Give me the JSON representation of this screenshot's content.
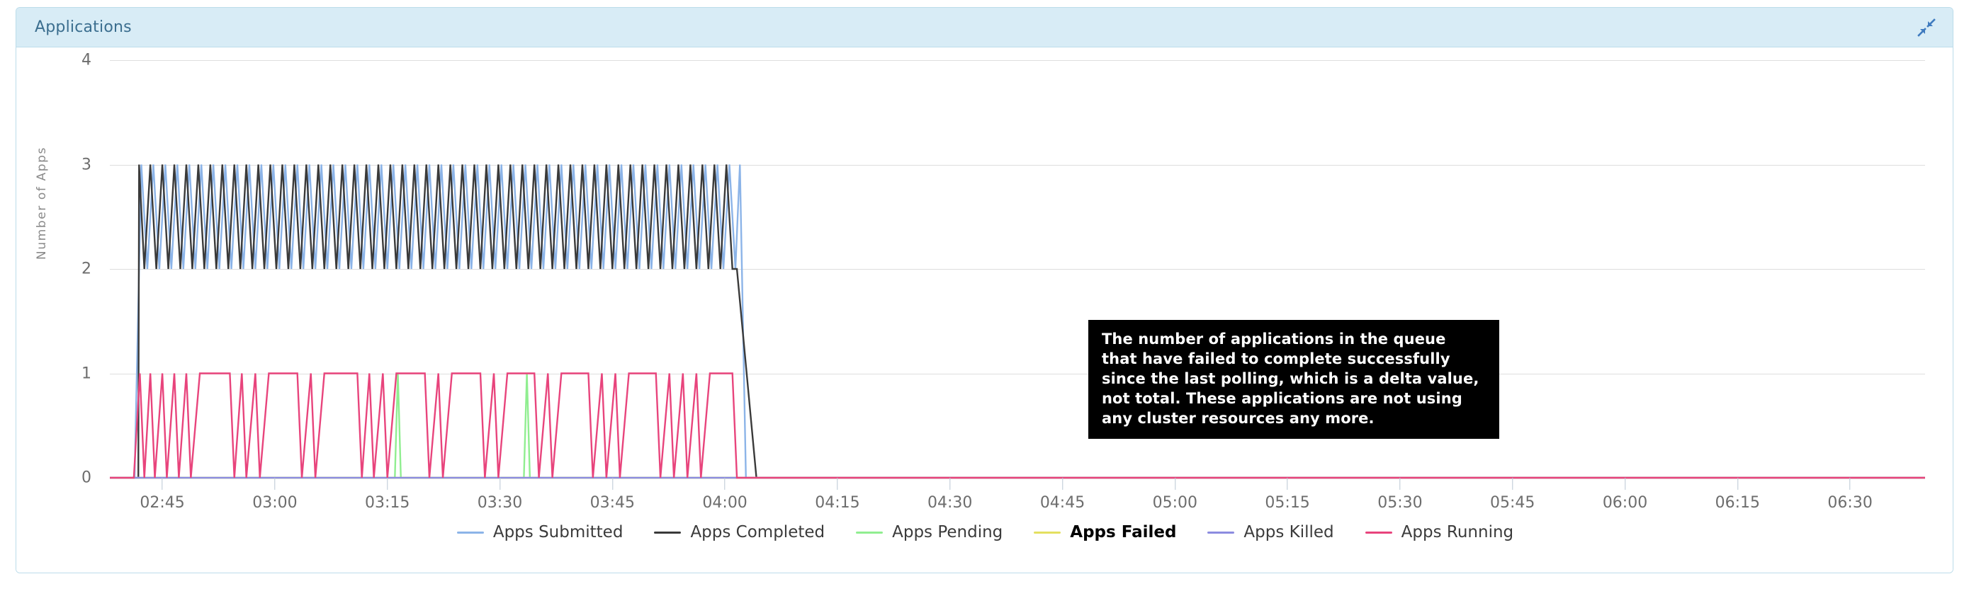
{
  "panel": {
    "title": "Applications",
    "collapse_icon": "collapse-arrows-icon",
    "header_bg": "#d8ecf6",
    "title_color": "#3b6e8f"
  },
  "tooltip": {
    "visible": true,
    "text": "The number of applications in the queue that have failed to complete successfully since the last polling, which is a delta value, not total. These applications are not using any cluster resources any more.",
    "bg": "#000000",
    "fg": "#ffffff"
  },
  "legend": {
    "items": [
      {
        "label": "Apps Submitted",
        "color": "#8cb4e8",
        "active": false
      },
      {
        "label": "Apps Completed",
        "color": "#3a3a3a",
        "active": false
      },
      {
        "label": "Apps Pending",
        "color": "#90ee90",
        "active": false
      },
      {
        "label": "Apps Failed",
        "color": "#e4e060",
        "active": true
      },
      {
        "label": "Apps Killed",
        "color": "#8c8ce0",
        "active": false
      },
      {
        "label": "Apps Running",
        "color": "#e8447c",
        "active": false
      }
    ]
  },
  "chart_data": {
    "type": "line",
    "title": "Applications",
    "xlabel": "",
    "ylabel": "Number of Apps",
    "ylim": [
      0,
      4
    ],
    "yticks": [
      0,
      1,
      2,
      3,
      4
    ],
    "grid": true,
    "legend_position": "bottom",
    "x_tick_labels": [
      "02:45",
      "03:00",
      "03:15",
      "03:30",
      "03:45",
      "04:00",
      "04:15",
      "04:30",
      "04:45",
      "05:00",
      "05:15",
      "05:30",
      "05:45",
      "06:00",
      "06:15",
      "06:30"
    ],
    "x_domain_minutes": [
      158,
      400
    ],
    "x_tick_minutes": [
      165,
      180,
      195,
      210,
      225,
      240,
      255,
      270,
      285,
      300,
      315,
      330,
      345,
      360,
      375,
      390
    ],
    "active_window_minutes": [
      161.5,
      243.5
    ],
    "series": [
      {
        "name": "Apps Submitted",
        "color": "#8cb4e8",
        "description": "Rises from 0 to 3 at ~02:41, oscillates between 2 and 3 until ~04:00, then drops to 0",
        "points": [
          [
            158,
            0
          ],
          [
            161.3,
            0
          ],
          [
            162.2,
            3
          ],
          [
            163,
            2
          ],
          [
            163.8,
            3
          ],
          [
            164.6,
            2
          ],
          [
            165.4,
            3
          ],
          [
            166.2,
            2
          ],
          [
            167,
            3
          ],
          [
            167.8,
            2
          ],
          [
            168.6,
            3
          ],
          [
            169.4,
            2
          ],
          [
            170.2,
            3
          ],
          [
            171,
            2
          ],
          [
            171.8,
            3
          ],
          [
            172.6,
            2
          ],
          [
            173.4,
            3
          ],
          [
            174.2,
            2
          ],
          [
            175,
            3
          ],
          [
            175.8,
            2
          ],
          [
            176.6,
            3
          ],
          [
            177.4,
            2
          ],
          [
            178.2,
            3
          ],
          [
            179,
            2
          ],
          [
            179.8,
            3
          ],
          [
            180.6,
            2
          ],
          [
            181.4,
            3
          ],
          [
            182.2,
            2
          ],
          [
            183,
            3
          ],
          [
            183.8,
            2
          ],
          [
            184.6,
            3
          ],
          [
            185.4,
            2
          ],
          [
            186.2,
            3
          ],
          [
            187,
            2
          ],
          [
            187.8,
            3
          ],
          [
            188.6,
            2
          ],
          [
            189.4,
            3
          ],
          [
            190.2,
            2
          ],
          [
            191,
            3
          ],
          [
            191.8,
            2
          ],
          [
            192.6,
            3
          ],
          [
            193.4,
            2
          ],
          [
            194.2,
            3
          ],
          [
            195,
            2
          ],
          [
            195.8,
            3
          ],
          [
            196.6,
            2
          ],
          [
            197.4,
            3
          ],
          [
            198.2,
            2
          ],
          [
            199,
            3
          ],
          [
            199.8,
            2
          ],
          [
            200.6,
            3
          ],
          [
            201.4,
            2
          ],
          [
            202.2,
            3
          ],
          [
            203,
            2
          ],
          [
            203.8,
            3
          ],
          [
            204.6,
            2
          ],
          [
            205.4,
            3
          ],
          [
            206.2,
            2
          ],
          [
            207,
            3
          ],
          [
            207.8,
            2
          ],
          [
            208.6,
            3
          ],
          [
            209.4,
            2
          ],
          [
            210.2,
            3
          ],
          [
            211,
            2
          ],
          [
            211.8,
            3
          ],
          [
            212.6,
            2
          ],
          [
            213.4,
            3
          ],
          [
            214.2,
            2
          ],
          [
            215,
            3
          ],
          [
            215.8,
            2
          ],
          [
            216.6,
            3
          ],
          [
            217.4,
            2
          ],
          [
            218.2,
            3
          ],
          [
            219,
            2
          ],
          [
            219.8,
            3
          ],
          [
            220.6,
            2
          ],
          [
            221.4,
            3
          ],
          [
            222.2,
            2
          ],
          [
            223,
            3
          ],
          [
            223.8,
            2
          ],
          [
            224.6,
            3
          ],
          [
            225.4,
            2
          ],
          [
            226.2,
            3
          ],
          [
            227,
            2
          ],
          [
            227.8,
            3
          ],
          [
            228.6,
            2
          ],
          [
            229.4,
            3
          ],
          [
            230.2,
            2
          ],
          [
            231,
            3
          ],
          [
            231.8,
            2
          ],
          [
            232.6,
            3
          ],
          [
            233.4,
            2
          ],
          [
            234.2,
            3
          ],
          [
            235,
            2
          ],
          [
            235.8,
            3
          ],
          [
            236.6,
            2
          ],
          [
            237.4,
            3
          ],
          [
            238.2,
            2
          ],
          [
            239,
            3
          ],
          [
            239.8,
            2
          ],
          [
            240.6,
            3
          ],
          [
            241.4,
            2
          ],
          [
            242,
            3
          ],
          [
            242.8,
            0
          ],
          [
            243.5,
            0
          ],
          [
            400,
            0
          ]
        ]
      },
      {
        "name": "Apps Completed",
        "color": "#3a3a3a",
        "description": "Sawtooth between 2 and 3 from ~02:42 to ~04:00, then falls to 0 by ~04:03",
        "points": [
          [
            158,
            0
          ],
          [
            161.8,
            0
          ],
          [
            161.9,
            3
          ],
          [
            162.6,
            2
          ],
          [
            163.4,
            3
          ],
          [
            164.2,
            2
          ],
          [
            165,
            3
          ],
          [
            165.8,
            2
          ],
          [
            166.6,
            3
          ],
          [
            167.4,
            2
          ],
          [
            168.2,
            3
          ],
          [
            169,
            2
          ],
          [
            169.8,
            3
          ],
          [
            170.6,
            2
          ],
          [
            171.4,
            3
          ],
          [
            172.2,
            2
          ],
          [
            173,
            3
          ],
          [
            173.8,
            2
          ],
          [
            174.6,
            3
          ],
          [
            175.4,
            2
          ],
          [
            176.2,
            3
          ],
          [
            177,
            2
          ],
          [
            177.8,
            3
          ],
          [
            178.6,
            2
          ],
          [
            179.4,
            3
          ],
          [
            180.2,
            2
          ],
          [
            181,
            3
          ],
          [
            181.8,
            2
          ],
          [
            182.6,
            3
          ],
          [
            183.4,
            2
          ],
          [
            184.2,
            3
          ],
          [
            185,
            2
          ],
          [
            185.8,
            3
          ],
          [
            186.6,
            2
          ],
          [
            187.4,
            3
          ],
          [
            188.2,
            2
          ],
          [
            189,
            3
          ],
          [
            189.8,
            2
          ],
          [
            190.6,
            3
          ],
          [
            191.4,
            2
          ],
          [
            192.2,
            3
          ],
          [
            193,
            2
          ],
          [
            193.8,
            3
          ],
          [
            194.6,
            2
          ],
          [
            195.4,
            3
          ],
          [
            196.2,
            2
          ],
          [
            197,
            3
          ],
          [
            197.8,
            2
          ],
          [
            198.6,
            3
          ],
          [
            199.4,
            2
          ],
          [
            200.2,
            3
          ],
          [
            201,
            2
          ],
          [
            201.8,
            3
          ],
          [
            202.6,
            2
          ],
          [
            203.4,
            3
          ],
          [
            204.2,
            2
          ],
          [
            205,
            3
          ],
          [
            205.8,
            2
          ],
          [
            206.6,
            3
          ],
          [
            207.4,
            2
          ],
          [
            208.2,
            3
          ],
          [
            209,
            2
          ],
          [
            209.8,
            3
          ],
          [
            210.6,
            2
          ],
          [
            211.4,
            3
          ],
          [
            212.2,
            2
          ],
          [
            213,
            3
          ],
          [
            213.8,
            2
          ],
          [
            214.6,
            3
          ],
          [
            215.4,
            2
          ],
          [
            216.2,
            3
          ],
          [
            217,
            2
          ],
          [
            217.8,
            3
          ],
          [
            218.6,
            2
          ],
          [
            219.4,
            3
          ],
          [
            220.2,
            2
          ],
          [
            221,
            3
          ],
          [
            221.8,
            2
          ],
          [
            222.6,
            3
          ],
          [
            223.4,
            2
          ],
          [
            224.2,
            3
          ],
          [
            225,
            2
          ],
          [
            225.8,
            3
          ],
          [
            226.6,
            2
          ],
          [
            227.4,
            3
          ],
          [
            228.2,
            2
          ],
          [
            229,
            3
          ],
          [
            229.8,
            2
          ],
          [
            230.6,
            3
          ],
          [
            231.4,
            2
          ],
          [
            232.2,
            3
          ],
          [
            233,
            2
          ],
          [
            233.8,
            3
          ],
          [
            234.6,
            2
          ],
          [
            235.4,
            3
          ],
          [
            236.2,
            2
          ],
          [
            237,
            3
          ],
          [
            237.8,
            2
          ],
          [
            238.6,
            3
          ],
          [
            239.4,
            2
          ],
          [
            240.2,
            3
          ],
          [
            241,
            2
          ],
          [
            241.6,
            2
          ],
          [
            244.2,
            0
          ],
          [
            400,
            0
          ]
        ]
      },
      {
        "name": "Apps Pending",
        "color": "#90ee90",
        "description": "Flat at 0 with brief spikes to 1 around 03:16 and 03:33",
        "points": [
          [
            158,
            0
          ],
          [
            196.0,
            0
          ],
          [
            196.4,
            1
          ],
          [
            196.8,
            0
          ],
          [
            213.2,
            0
          ],
          [
            213.6,
            1
          ],
          [
            214.0,
            0
          ],
          [
            400,
            0
          ]
        ]
      },
      {
        "name": "Apps Failed",
        "color": "#e4e060",
        "description": "Flat at 0 across the whole window",
        "points": [
          [
            158,
            0
          ],
          [
            400,
            0
          ]
        ]
      },
      {
        "name": "Apps Killed",
        "color": "#8c8ce0",
        "description": "Flat at 0 across the whole window",
        "points": [
          [
            158,
            0
          ],
          [
            400,
            0
          ]
        ]
      },
      {
        "name": "Apps Running",
        "color": "#e8447c",
        "description": "Square-wave between 0 and 1 from ~02:41 to ~04:00, then flat at 0",
        "points": [
          [
            158,
            0
          ],
          [
            161.2,
            0
          ],
          [
            162.0,
            1
          ],
          [
            162.6,
            0
          ],
          [
            163.4,
            1
          ],
          [
            164.0,
            0
          ],
          [
            165.0,
            1
          ],
          [
            165.6,
            0
          ],
          [
            166.6,
            1
          ],
          [
            167.2,
            0
          ],
          [
            168.2,
            1
          ],
          [
            168.8,
            0
          ],
          [
            170.0,
            1
          ],
          [
            174.0,
            1
          ],
          [
            174.6,
            0
          ],
          [
            175.6,
            1
          ],
          [
            176.2,
            0
          ],
          [
            177.4,
            1
          ],
          [
            178.0,
            0
          ],
          [
            179.2,
            1
          ],
          [
            183.0,
            1
          ],
          [
            183.6,
            0
          ],
          [
            184.8,
            1
          ],
          [
            185.4,
            0
          ],
          [
            186.6,
            1
          ],
          [
            191.0,
            1
          ],
          [
            191.6,
            0
          ],
          [
            192.6,
            1
          ],
          [
            193.2,
            0
          ],
          [
            194.4,
            1
          ],
          [
            195.0,
            0
          ],
          [
            196.2,
            1
          ],
          [
            200.0,
            1
          ],
          [
            200.6,
            0
          ],
          [
            201.8,
            1
          ],
          [
            202.4,
            0
          ],
          [
            203.6,
            1
          ],
          [
            207.4,
            1
          ],
          [
            208.0,
            0
          ],
          [
            209.2,
            1
          ],
          [
            209.8,
            0
          ],
          [
            211.0,
            1
          ],
          [
            214.6,
            1
          ],
          [
            215.2,
            0
          ],
          [
            216.4,
            1
          ],
          [
            217.0,
            0
          ],
          [
            218.2,
            1
          ],
          [
            221.8,
            1
          ],
          [
            222.4,
            0
          ],
          [
            223.6,
            1
          ],
          [
            224.2,
            0
          ],
          [
            225.4,
            1
          ],
          [
            226.0,
            0
          ],
          [
            227.2,
            1
          ],
          [
            230.8,
            1
          ],
          [
            231.4,
            0
          ],
          [
            232.6,
            1
          ],
          [
            233.2,
            0
          ],
          [
            234.4,
            1
          ],
          [
            235.0,
            0
          ],
          [
            236.2,
            1
          ],
          [
            236.8,
            0
          ],
          [
            238.0,
            1
          ],
          [
            241.0,
            1
          ],
          [
            241.6,
            0
          ],
          [
            242.4,
            0
          ],
          [
            400,
            0
          ]
        ]
      }
    ]
  }
}
